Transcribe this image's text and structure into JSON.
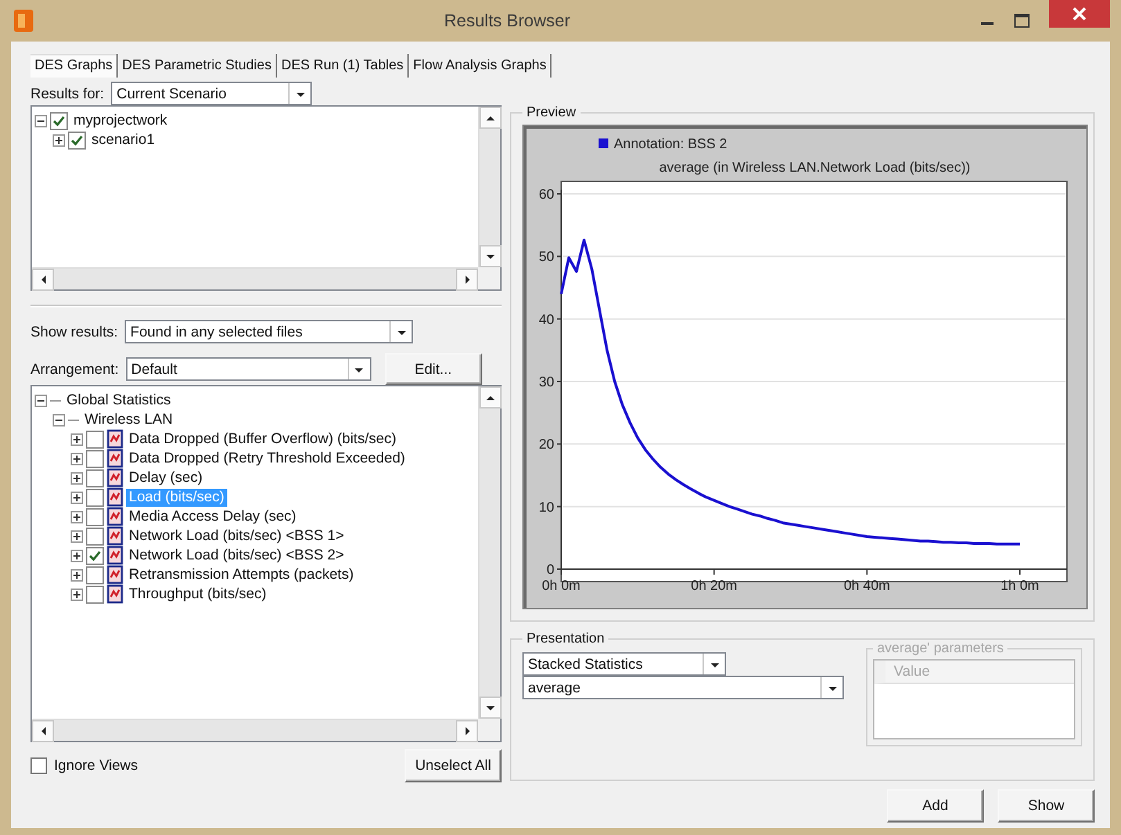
{
  "window": {
    "title": "Results Browser"
  },
  "tabs": [
    {
      "label": "DES Graphs",
      "selected": true
    },
    {
      "label": "DES Parametric Studies",
      "selected": false
    },
    {
      "label": "DES Run (1) Tables",
      "selected": false
    },
    {
      "label": "Flow Analysis Graphs",
      "selected": false
    }
  ],
  "results_for": {
    "label": "Results for:",
    "value": "Current Scenario"
  },
  "scenario_tree": [
    {
      "label": "myprojectwork",
      "checked": true,
      "expanded": true,
      "children": [
        {
          "label": "scenario1",
          "checked": true,
          "expanded": false
        }
      ]
    }
  ],
  "show_results": {
    "label": "Show results:",
    "value": "Found in any selected files"
  },
  "arrangement": {
    "label": "Arrangement:",
    "value": "Default"
  },
  "edit_button": "Edit...",
  "statistics_tree": [
    {
      "label": "Global Statistics",
      "kind": "folder",
      "expanded": true,
      "children": [
        {
          "label": "Wireless LAN",
          "kind": "folder",
          "expanded": true,
          "children": [
            {
              "label": "Data Dropped (Buffer Overflow) (bits/sec)",
              "kind": "statistic",
              "expanded": false,
              "checked": false,
              "selected": false
            },
            {
              "label": "Data Dropped (Retry Threshold Exceeded)",
              "kind": "statistic",
              "expanded": false,
              "checked": false,
              "selected": false
            },
            {
              "label": "Delay (sec)",
              "kind": "statistic",
              "expanded": false,
              "checked": false,
              "selected": false
            },
            {
              "label": "Load (bits/sec)",
              "kind": "statistic",
              "expanded": false,
              "checked": false,
              "selected": true
            },
            {
              "label": "Media Access Delay (sec)",
              "kind": "statistic",
              "expanded": false,
              "checked": false,
              "selected": false
            },
            {
              "label": "Network Load (bits/sec) <BSS 1>",
              "kind": "statistic",
              "expanded": false,
              "checked": false,
              "selected": false
            },
            {
              "label": "Network Load (bits/sec) <BSS 2>",
              "kind": "statistic",
              "expanded": false,
              "checked": true,
              "selected": false
            },
            {
              "label": "Retransmission Attempts (packets)",
              "kind": "statistic",
              "expanded": false,
              "checked": false,
              "selected": false
            },
            {
              "label": "Throughput (bits/sec)",
              "kind": "statistic",
              "expanded": false,
              "checked": false,
              "selected": false
            }
          ]
        }
      ]
    }
  ],
  "ignore_views": {
    "label": "Ignore Views",
    "checked": false
  },
  "unselect_all_button": "Unselect All",
  "preview": {
    "title": "Preview",
    "chart_data": {
      "type": "line",
      "title": "average (in Wireless LAN.Network Load (bits/sec))",
      "categories": [
        "0h 0m",
        null,
        null,
        null,
        null,
        null,
        null,
        null,
        null,
        null,
        null,
        null,
        null,
        null,
        null,
        null,
        null,
        null,
        null,
        null,
        "0h 20m",
        null,
        null,
        null,
        null,
        null,
        null,
        null,
        null,
        null,
        null,
        null,
        null,
        null,
        null,
        null,
        null,
        null,
        null,
        null,
        "0h 40m",
        null,
        null,
        null,
        null,
        null,
        null,
        null,
        null,
        null,
        null,
        null,
        null,
        null,
        null,
        null,
        null,
        null,
        null,
        null,
        "1h 0m"
      ],
      "series": [
        {
          "name": "Annotation: BSS 2",
          "color": "#1a10d0",
          "values": [
            44,
            49.8,
            47.6,
            52.6,
            48,
            41.5,
            35,
            30,
            26.3,
            23.4,
            21,
            19.1,
            17.6,
            16.3,
            15.2,
            14.3,
            13.5,
            12.8,
            12.1,
            11.5,
            11,
            10.5,
            10,
            9.6,
            9.2,
            8.8,
            8.5,
            8.1,
            7.8,
            7.4,
            7.2,
            7,
            6.8,
            6.6,
            6.4,
            6.2,
            6,
            5.8,
            5.6,
            5.4,
            5.2,
            5.1,
            5,
            4.9,
            4.8,
            4.7,
            4.6,
            4.5,
            4.5,
            4.4,
            4.3,
            4.3,
            4.2,
            4.2,
            4.1,
            4.1,
            4.1,
            4,
            4,
            4,
            4
          ]
        }
      ],
      "ylim": [
        0,
        60
      ],
      "grid": true,
      "yticks": [
        0,
        10,
        20,
        30,
        40,
        50,
        60
      ]
    }
  },
  "presentation": {
    "title": "Presentation",
    "mode": "Stacked Statistics",
    "filter": "average",
    "parameters": {
      "title": "average' parameters",
      "column": "Value",
      "disabled": true
    }
  },
  "buttons": [
    {
      "label": "Add"
    },
    {
      "label": "Show"
    }
  ]
}
